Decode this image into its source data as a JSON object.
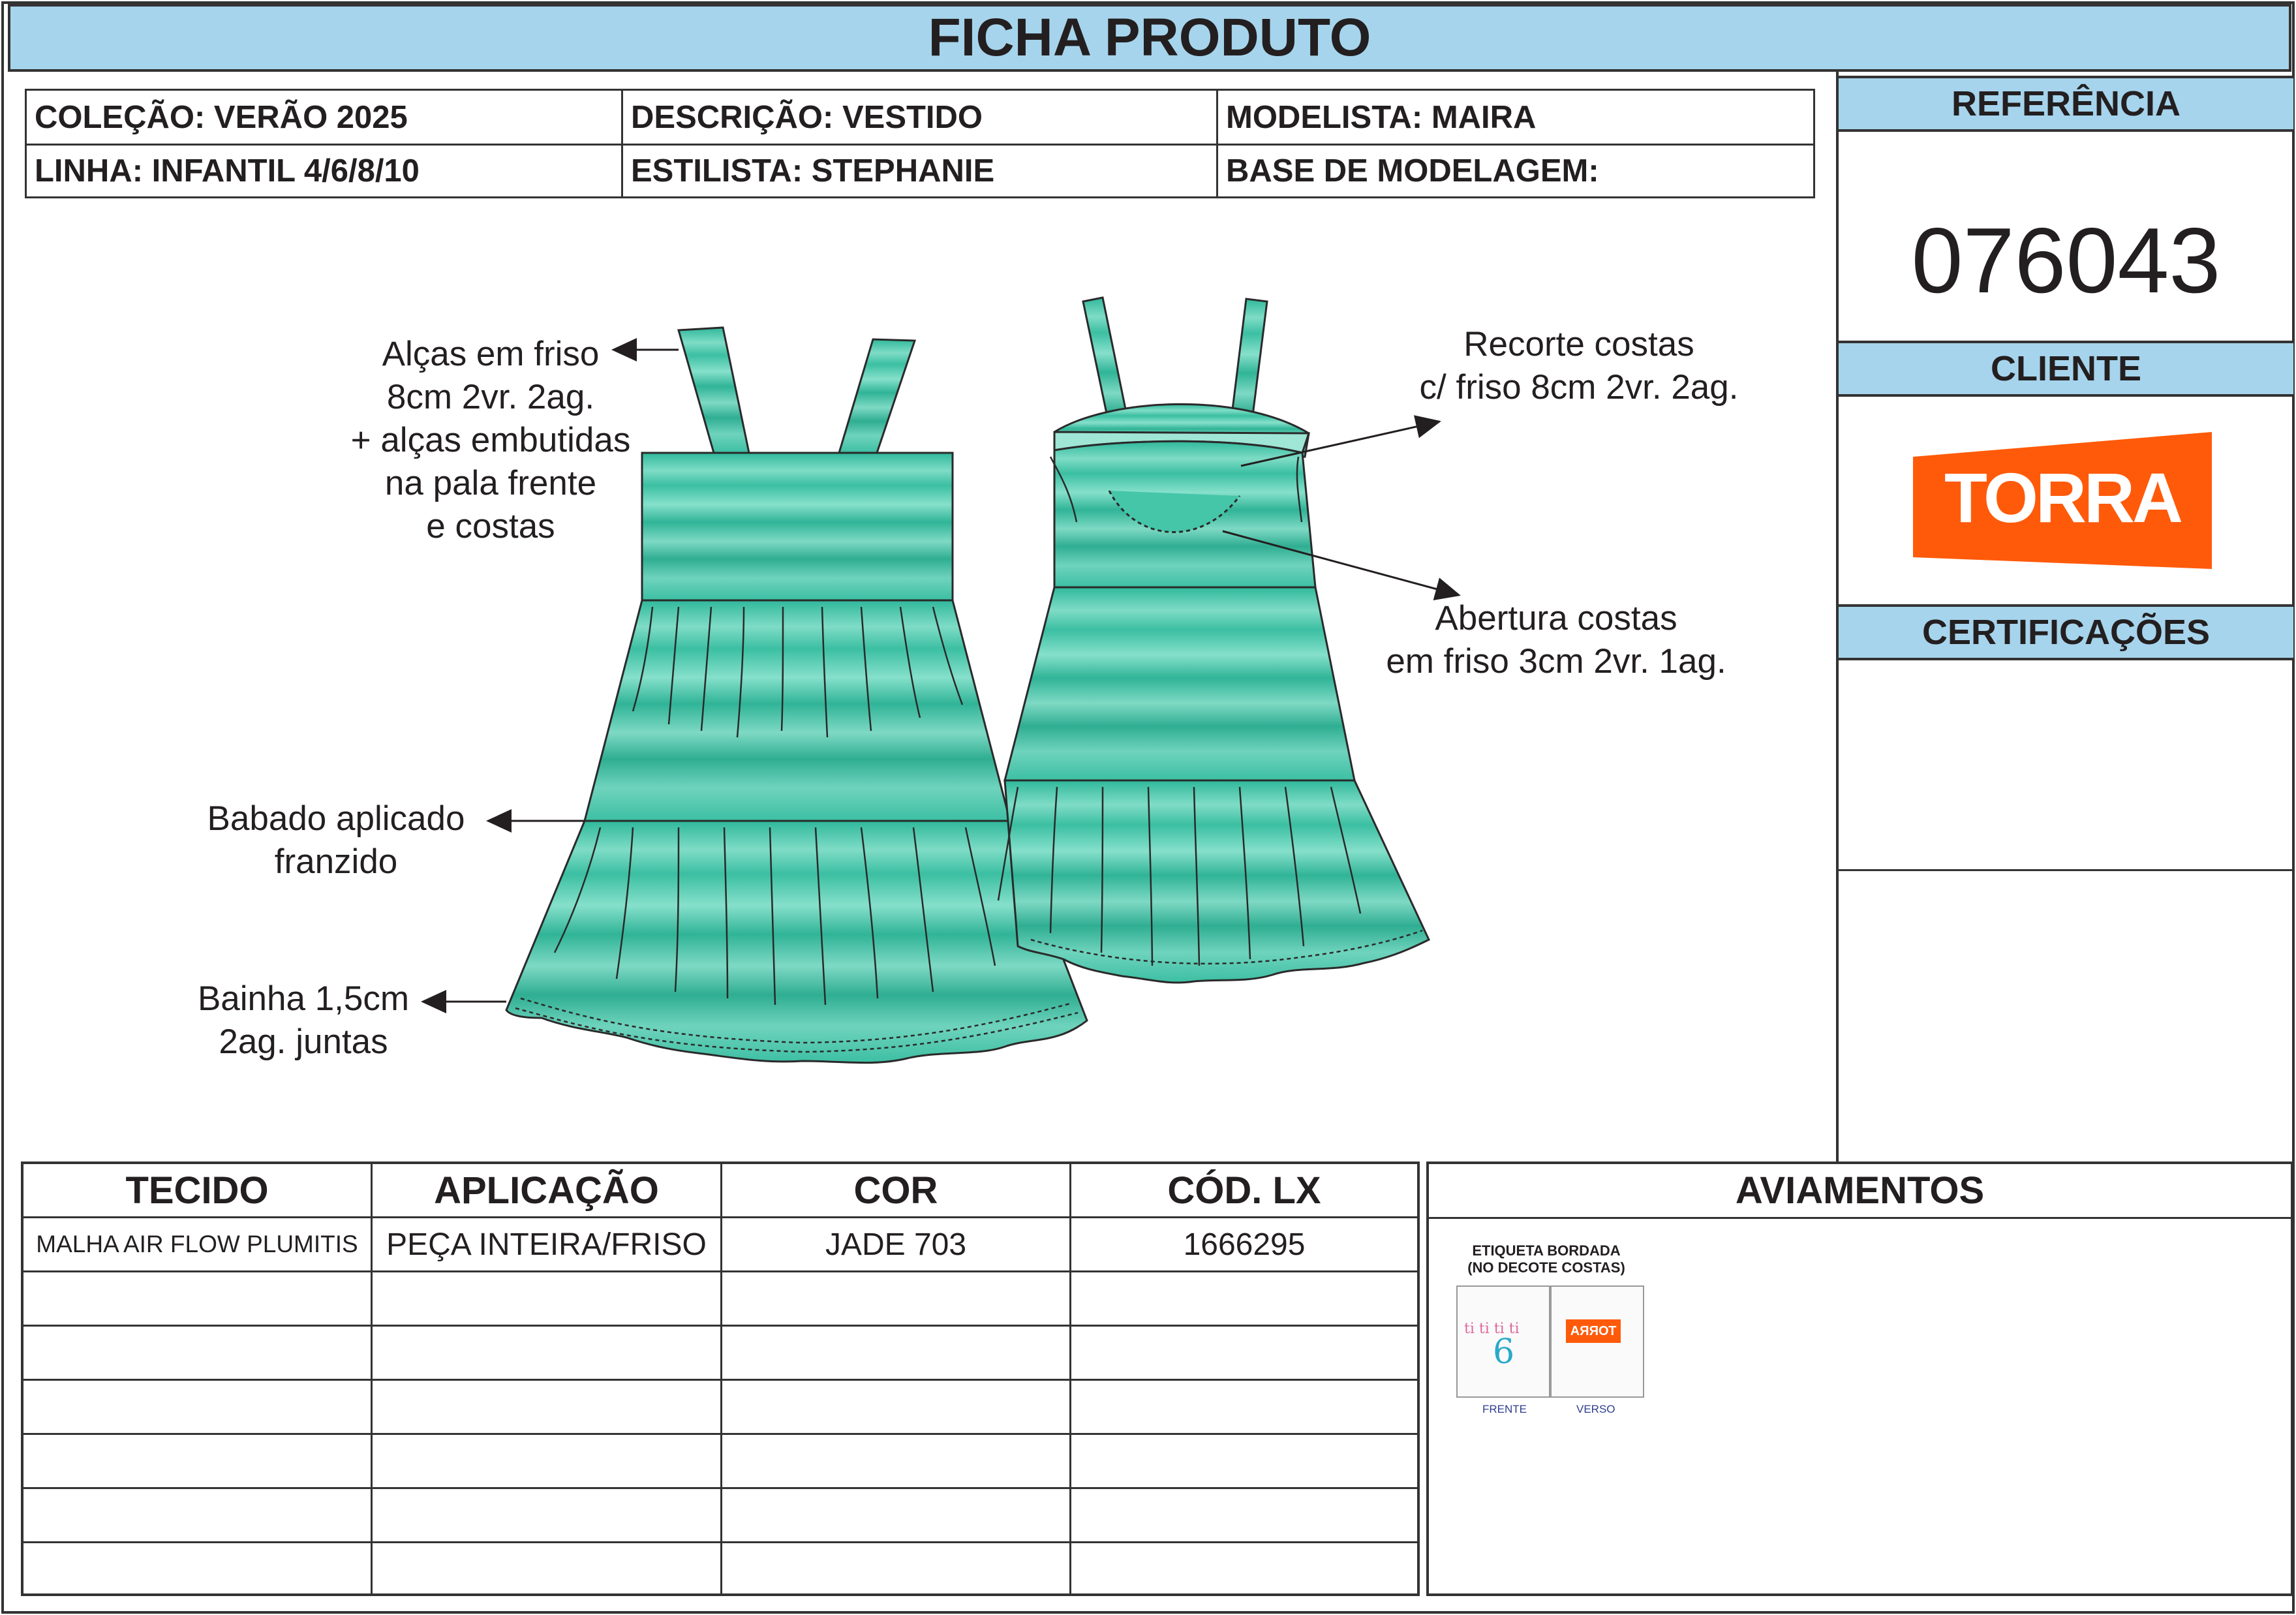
{
  "header": {
    "title": "FICHA PRODUTO"
  },
  "info": {
    "colecao": "COLEÇÃO: VERÃO 2025",
    "descricao": "DESCRIÇÃO: VESTIDO",
    "modelista": "MODELISTA: MAIRA",
    "linha": "LINHA: INFANTIL 4/6/8/10",
    "estilista": "ESTILISTA: STEPHANIE",
    "base_modelagem": "BASE DE MODELAGEM:"
  },
  "sidebar": {
    "referencia_label": "REFERÊNCIA",
    "referencia_value": "076043",
    "cliente_label": "CLIENTE",
    "cliente_logo_text": "TORRA",
    "certificacoes_label": "CERTIFICAÇÕES"
  },
  "annotations": {
    "alcas": [
      "Alças em friso",
      "8cm 2vr. 2ag.",
      "+ alças embutidas",
      "na pala frente",
      "e costas"
    ],
    "babado": [
      "Babado aplicado",
      "franzido"
    ],
    "bainha": [
      "Bainha 1,5cm",
      "2ag. juntas"
    ],
    "recorte": [
      "Recorte costas",
      "c/ friso 8cm 2vr. 2ag."
    ],
    "abertura": [
      "Abertura costas",
      "em friso 3cm 2vr. 1ag."
    ]
  },
  "fabric_table": {
    "headers": [
      "TECIDO",
      "APLICAÇÃO",
      "COR",
      "CÓD. LX"
    ],
    "rows": [
      [
        "MALHA AIR FLOW PLUMITIS",
        "PEÇA INTEIRA/FRISO",
        "JADE 703",
        "1666295"
      ]
    ]
  },
  "aviamentos": {
    "title": "AVIAMENTOS",
    "label_title_1": "ETIQUETA BORDADA",
    "label_title_2": "(NO DECOTE COSTAS)",
    "label_size": "6",
    "label_brand": "TORRA",
    "front_caption": "FRENTE",
    "back_caption": "VERSO"
  },
  "colors": {
    "header_blue": "#a6d4ec",
    "torra_orange": "#ff5a0a",
    "jade": "#5ccfb5"
  }
}
